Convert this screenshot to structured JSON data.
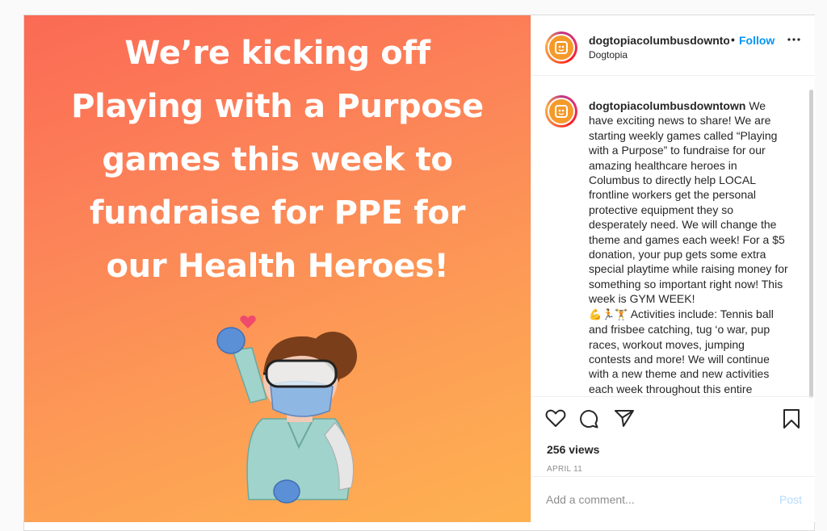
{
  "media": {
    "headline_lines": [
      "We’re kicking off",
      "Playing with a Purpose",
      "games this week to",
      "fundraise for PPE for",
      "our Health Heroes!"
    ]
  },
  "header": {
    "username": "dogtopiacolumbusdowntown",
    "dot": "•",
    "follow_label": "Follow",
    "location": "Dogtopia"
  },
  "caption": {
    "username": "dogtopiacolumbusdowntown",
    "text_part1": "We have exciting news to share! We are starting weekly games called “Playing with a Purpose” to fundraise for our amazing healthcare heroes in Columbus to directly help LOCAL frontline workers get the personal protective equipment they so desperately need. We will change the theme and games each week! For a $5 donation, your pup gets some extra special playtime while raising money for something so important right now! This week is GYM WEEK!",
    "emojis": "💪🏃🏋",
    "text_part2": "Activities include: Tennis ball and frisbee catching, tug ‘o war, pup races, workout moves, jumping contests and more! We will continue with a new theme and new activities each week throughout this entire"
  },
  "stats": {
    "views": "256 views",
    "date": "APRIL 11"
  },
  "comment": {
    "placeholder": "Add a comment...",
    "post_label": "Post"
  },
  "colors": {
    "accent": "#0095f6",
    "brand_orange": "#f59a2a"
  }
}
